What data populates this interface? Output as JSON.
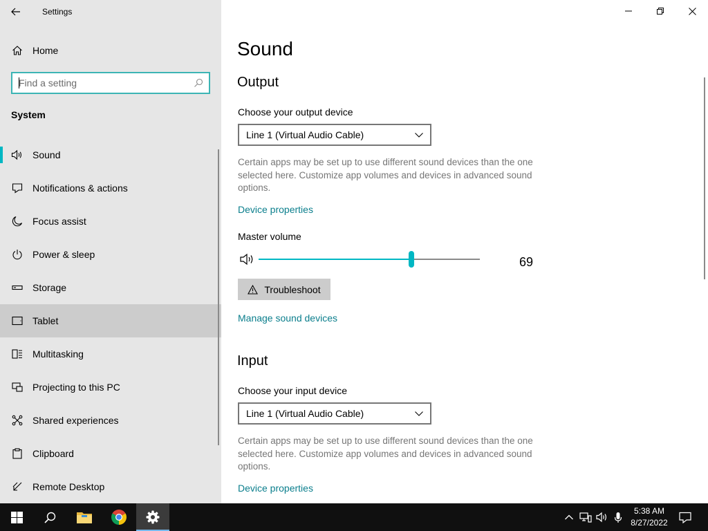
{
  "window": {
    "title": "Settings"
  },
  "sidebar": {
    "home_label": "Home",
    "search_placeholder": "Find a setting",
    "section_title": "System",
    "items": [
      {
        "label": "Sound",
        "icon": "speaker-icon",
        "selected": true
      },
      {
        "label": "Notifications & actions",
        "icon": "notification-icon"
      },
      {
        "label": "Focus assist",
        "icon": "moon-icon"
      },
      {
        "label": "Power & sleep",
        "icon": "power-icon"
      },
      {
        "label": "Storage",
        "icon": "storage-icon"
      },
      {
        "label": "Tablet",
        "icon": "tablet-icon",
        "hover": true
      },
      {
        "label": "Multitasking",
        "icon": "multitasking-icon"
      },
      {
        "label": "Projecting to this PC",
        "icon": "projecting-icon"
      },
      {
        "label": "Shared experiences",
        "icon": "shared-experiences-icon"
      },
      {
        "label": "Clipboard",
        "icon": "clipboard-icon"
      },
      {
        "label": "Remote Desktop",
        "icon": "remote-desktop-icon"
      }
    ]
  },
  "main": {
    "page_title": "Sound",
    "output": {
      "title": "Output",
      "device_label": "Choose your output device",
      "device_value": "Line 1 (Virtual Audio Cable)",
      "description": "Certain apps may be set up to use different sound devices than the one selected here. Customize app volumes and devices in advanced sound options.",
      "device_properties_link": "Device properties",
      "master_volume_label": "Master volume",
      "master_volume_value": 69,
      "troubleshoot_label": "Troubleshoot",
      "manage_link": "Manage sound devices"
    },
    "input": {
      "title": "Input",
      "device_label": "Choose your input device",
      "device_value": "Line 1 (Virtual Audio Cable)",
      "description": "Certain apps may be set up to use different sound devices than the one selected here. Customize app volumes and devices in advanced sound options.",
      "device_properties_link": "Device properties"
    }
  },
  "taskbar": {
    "time": "5:38 AM",
    "date": "8/27/2022",
    "apps": [
      "start-icon",
      "search-icon",
      "file-explorer-icon",
      "chrome-icon",
      "settings-icon"
    ],
    "tray": [
      "chevron-up-icon",
      "network-icon",
      "volume-icon",
      "microphone-icon"
    ]
  },
  "colors": {
    "accent": "#00b7c3",
    "link": "#0a7e8c",
    "search_border": "#3cb4b4",
    "sidebar_bg": "#e6e6e6",
    "taskbar_bg": "#101010"
  }
}
